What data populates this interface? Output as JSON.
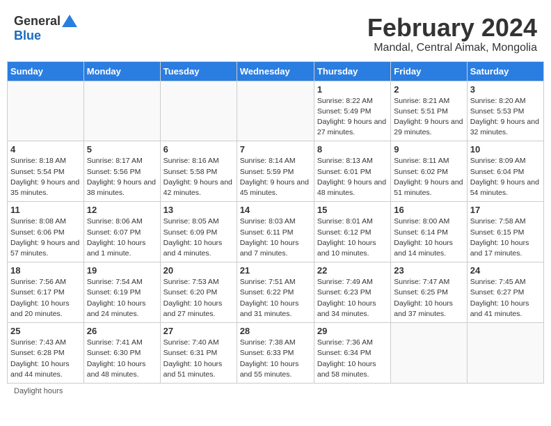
{
  "logo": {
    "general": "General",
    "blue": "Blue"
  },
  "title": "February 2024",
  "subtitle": "Mandal, Central Aimak, Mongolia",
  "days_of_week": [
    "Sunday",
    "Monday",
    "Tuesday",
    "Wednesday",
    "Thursday",
    "Friday",
    "Saturday"
  ],
  "weeks": [
    [
      {
        "day": "",
        "info": ""
      },
      {
        "day": "",
        "info": ""
      },
      {
        "day": "",
        "info": ""
      },
      {
        "day": "",
        "info": ""
      },
      {
        "day": "1",
        "info": "Sunrise: 8:22 AM\nSunset: 5:49 PM\nDaylight: 9 hours and 27 minutes."
      },
      {
        "day": "2",
        "info": "Sunrise: 8:21 AM\nSunset: 5:51 PM\nDaylight: 9 hours and 29 minutes."
      },
      {
        "day": "3",
        "info": "Sunrise: 8:20 AM\nSunset: 5:53 PM\nDaylight: 9 hours and 32 minutes."
      }
    ],
    [
      {
        "day": "4",
        "info": "Sunrise: 8:18 AM\nSunset: 5:54 PM\nDaylight: 9 hours and 35 minutes."
      },
      {
        "day": "5",
        "info": "Sunrise: 8:17 AM\nSunset: 5:56 PM\nDaylight: 9 hours and 38 minutes."
      },
      {
        "day": "6",
        "info": "Sunrise: 8:16 AM\nSunset: 5:58 PM\nDaylight: 9 hours and 42 minutes."
      },
      {
        "day": "7",
        "info": "Sunrise: 8:14 AM\nSunset: 5:59 PM\nDaylight: 9 hours and 45 minutes."
      },
      {
        "day": "8",
        "info": "Sunrise: 8:13 AM\nSunset: 6:01 PM\nDaylight: 9 hours and 48 minutes."
      },
      {
        "day": "9",
        "info": "Sunrise: 8:11 AM\nSunset: 6:02 PM\nDaylight: 9 hours and 51 minutes."
      },
      {
        "day": "10",
        "info": "Sunrise: 8:09 AM\nSunset: 6:04 PM\nDaylight: 9 hours and 54 minutes."
      }
    ],
    [
      {
        "day": "11",
        "info": "Sunrise: 8:08 AM\nSunset: 6:06 PM\nDaylight: 9 hours and 57 minutes."
      },
      {
        "day": "12",
        "info": "Sunrise: 8:06 AM\nSunset: 6:07 PM\nDaylight: 10 hours and 1 minute."
      },
      {
        "day": "13",
        "info": "Sunrise: 8:05 AM\nSunset: 6:09 PM\nDaylight: 10 hours and 4 minutes."
      },
      {
        "day": "14",
        "info": "Sunrise: 8:03 AM\nSunset: 6:11 PM\nDaylight: 10 hours and 7 minutes."
      },
      {
        "day": "15",
        "info": "Sunrise: 8:01 AM\nSunset: 6:12 PM\nDaylight: 10 hours and 10 minutes."
      },
      {
        "day": "16",
        "info": "Sunrise: 8:00 AM\nSunset: 6:14 PM\nDaylight: 10 hours and 14 minutes."
      },
      {
        "day": "17",
        "info": "Sunrise: 7:58 AM\nSunset: 6:15 PM\nDaylight: 10 hours and 17 minutes."
      }
    ],
    [
      {
        "day": "18",
        "info": "Sunrise: 7:56 AM\nSunset: 6:17 PM\nDaylight: 10 hours and 20 minutes."
      },
      {
        "day": "19",
        "info": "Sunrise: 7:54 AM\nSunset: 6:19 PM\nDaylight: 10 hours and 24 minutes."
      },
      {
        "day": "20",
        "info": "Sunrise: 7:53 AM\nSunset: 6:20 PM\nDaylight: 10 hours and 27 minutes."
      },
      {
        "day": "21",
        "info": "Sunrise: 7:51 AM\nSunset: 6:22 PM\nDaylight: 10 hours and 31 minutes."
      },
      {
        "day": "22",
        "info": "Sunrise: 7:49 AM\nSunset: 6:23 PM\nDaylight: 10 hours and 34 minutes."
      },
      {
        "day": "23",
        "info": "Sunrise: 7:47 AM\nSunset: 6:25 PM\nDaylight: 10 hours and 37 minutes."
      },
      {
        "day": "24",
        "info": "Sunrise: 7:45 AM\nSunset: 6:27 PM\nDaylight: 10 hours and 41 minutes."
      }
    ],
    [
      {
        "day": "25",
        "info": "Sunrise: 7:43 AM\nSunset: 6:28 PM\nDaylight: 10 hours and 44 minutes."
      },
      {
        "day": "26",
        "info": "Sunrise: 7:41 AM\nSunset: 6:30 PM\nDaylight: 10 hours and 48 minutes."
      },
      {
        "day": "27",
        "info": "Sunrise: 7:40 AM\nSunset: 6:31 PM\nDaylight: 10 hours and 51 minutes."
      },
      {
        "day": "28",
        "info": "Sunrise: 7:38 AM\nSunset: 6:33 PM\nDaylight: 10 hours and 55 minutes."
      },
      {
        "day": "29",
        "info": "Sunrise: 7:36 AM\nSunset: 6:34 PM\nDaylight: 10 hours and 58 minutes."
      },
      {
        "day": "",
        "info": ""
      },
      {
        "day": "",
        "info": ""
      }
    ]
  ],
  "footer": "Daylight hours"
}
